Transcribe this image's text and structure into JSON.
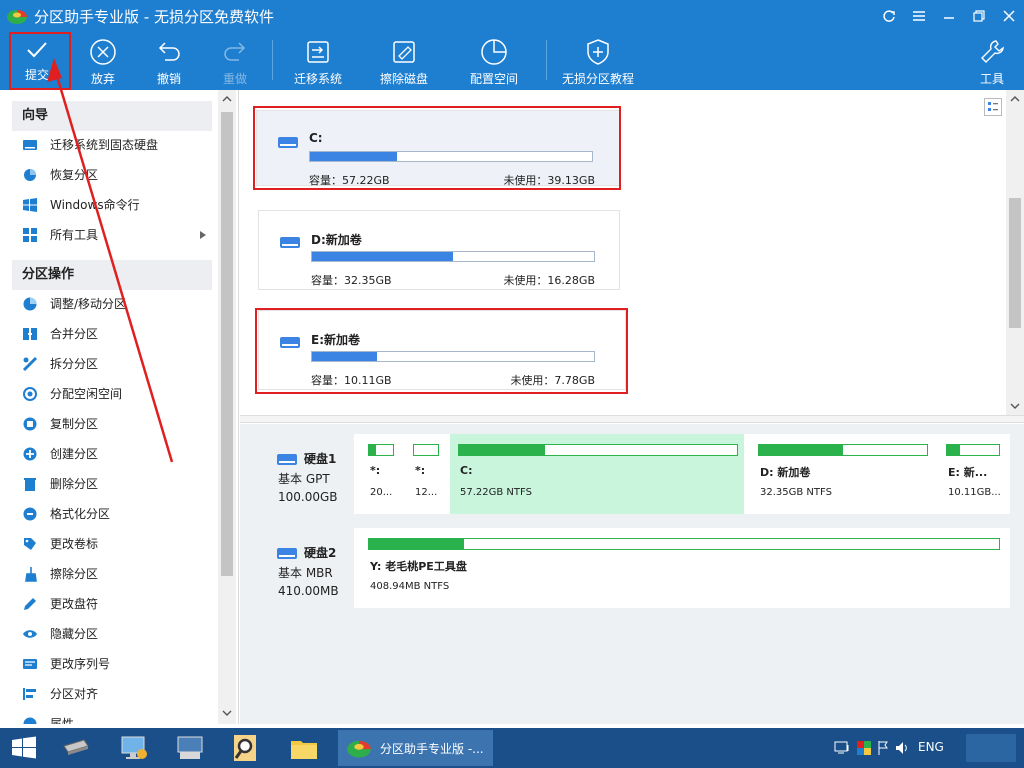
{
  "titlebar": {
    "title": "分区助手专业版 - 无损分区免费软件"
  },
  "toolbar": {
    "commit": "提交",
    "discard": "放弃",
    "undo": "撤销",
    "redo": "重做",
    "migrate": "迁移系统",
    "wipe": "擦除磁盘",
    "config": "配置空间",
    "tutorial": "无损分区教程",
    "tools": "工具"
  },
  "sidebar": {
    "wizard_header": "向导",
    "wizard_items": [
      "迁移系统到固态硬盘",
      "恢复分区",
      "Windows命令行",
      "所有工具"
    ],
    "ops_header": "分区操作",
    "ops_items": [
      "调整/移动分区",
      "合并分区",
      "拆分分区",
      "分配空闲空间",
      "复制分区",
      "创建分区",
      "删除分区",
      "格式化分区",
      "更改卷标",
      "擦除分区",
      "更改盘符",
      "隐藏分区",
      "更改序列号",
      "分区对齐",
      "属性"
    ]
  },
  "volumes": [
    {
      "name": "C:",
      "capacity": "容量：57.22GB",
      "free": "未使用：39.13GB",
      "used_fraction": 0.31
    },
    {
      "name": "D:新加卷",
      "capacity": "容量：32.35GB",
      "free": "未使用：16.28GB",
      "used_fraction": 0.5
    },
    {
      "name": "E:新加卷",
      "capacity": "容量：10.11GB",
      "free": "未使用：7.78GB",
      "used_fraction": 0.23
    }
  ],
  "disks": [
    {
      "name": "硬盘1",
      "type": "基本 GPT",
      "size": "100.00GB",
      "partitions": [
        {
          "label": "*:",
          "info": "20...",
          "used_fraction": 0.3
        },
        {
          "label": "*:",
          "info": "12...",
          "used_fraction": 0.0
        },
        {
          "label": "C:",
          "info": "57.22GB NTFS",
          "used_fraction": 0.31
        },
        {
          "label": "D: 新加卷",
          "info": "32.35GB NTFS",
          "used_fraction": 0.5
        },
        {
          "label": "E: 新...",
          "info": "10.11GB...",
          "used_fraction": 0.25
        }
      ]
    },
    {
      "name": "硬盘2",
      "type": "基本 MBR",
      "size": "410.00MB",
      "partitions": [
        {
          "label": "Y: 老毛桃PE工具盘",
          "info": "408.94MB NTFS",
          "used_fraction": 0.15
        }
      ]
    }
  ],
  "taskbar": {
    "app_title": "分区助手专业版 -...",
    "lang": "ENG"
  },
  "colors": {
    "accent": "#1e7ed0",
    "volume_bar": "#3c84e4",
    "partition_bar": "#2bb24c",
    "highlight": "#e02020",
    "selected_partition": "#c8f5dc"
  }
}
